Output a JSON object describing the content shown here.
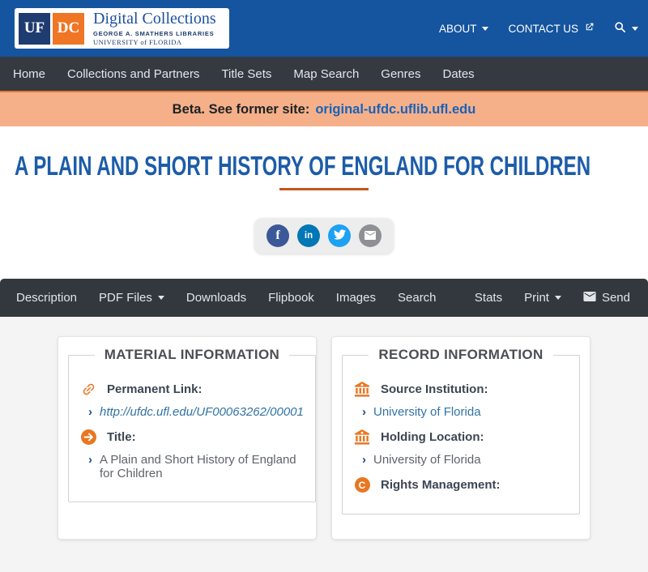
{
  "header": {
    "logo": {
      "uf": "UF",
      "dc": "DC",
      "title": "Digital Collections",
      "libraries": "GEORGE A. SMATHERS LIBRARIES",
      "university": "UNIVERSITY of FLORIDA"
    },
    "about_label": "ABOUT",
    "contact_label": "CONTACT US"
  },
  "nav": {
    "items": [
      "Home",
      "Collections and Partners",
      "Title Sets",
      "Map Search",
      "Genres",
      "Dates"
    ]
  },
  "banner": {
    "message": "Beta. See former site:",
    "link_text": "original-ufdc.uflib.ufl.edu"
  },
  "item": {
    "title": "A PLAIN AND SHORT HISTORY OF ENGLAND FOR CHILDREN"
  },
  "social": {
    "facebook_glyph": "f",
    "linkedin_glyph": "in",
    "icons": [
      "facebook-icon",
      "linkedin-icon",
      "twitter-icon",
      "email-icon"
    ]
  },
  "toolbar": {
    "left": [
      "Description",
      "PDF Files",
      "Downloads",
      "Flipbook",
      "Images",
      "Search"
    ],
    "right": {
      "stats": "Stats",
      "print": "Print",
      "send": "Send"
    }
  },
  "material_info": {
    "title": "MATERIAL INFORMATION",
    "fields": [
      {
        "icon": "link-icon",
        "label": "Permanent Link:",
        "value": "http://ufdc.ufl.edu/UF00063262/00001"
      },
      {
        "icon": "arrow-circle-icon",
        "label": "Title:",
        "value": "A Plain and Short History of England for Children"
      }
    ]
  },
  "record_info": {
    "title": "RECORD INFORMATION",
    "fields": [
      {
        "icon": "university-icon",
        "label": "Source Institution:",
        "value": "University of Florida"
      },
      {
        "icon": "university-icon",
        "label": "Holding Location:",
        "value": "University of Florida"
      },
      {
        "icon": "copyright-icon",
        "label": "Rights Management:"
      }
    ]
  },
  "colors": {
    "header_blue": "#15549e",
    "nav_dark": "#343a40",
    "toolbar_dark": "#32383e",
    "banner_peach": "#f5b08a",
    "brand_orange": "#e87722",
    "title_blue": "#1d5ca8",
    "link_blue": "#3173a5",
    "underline_orange": "#c2571b"
  }
}
